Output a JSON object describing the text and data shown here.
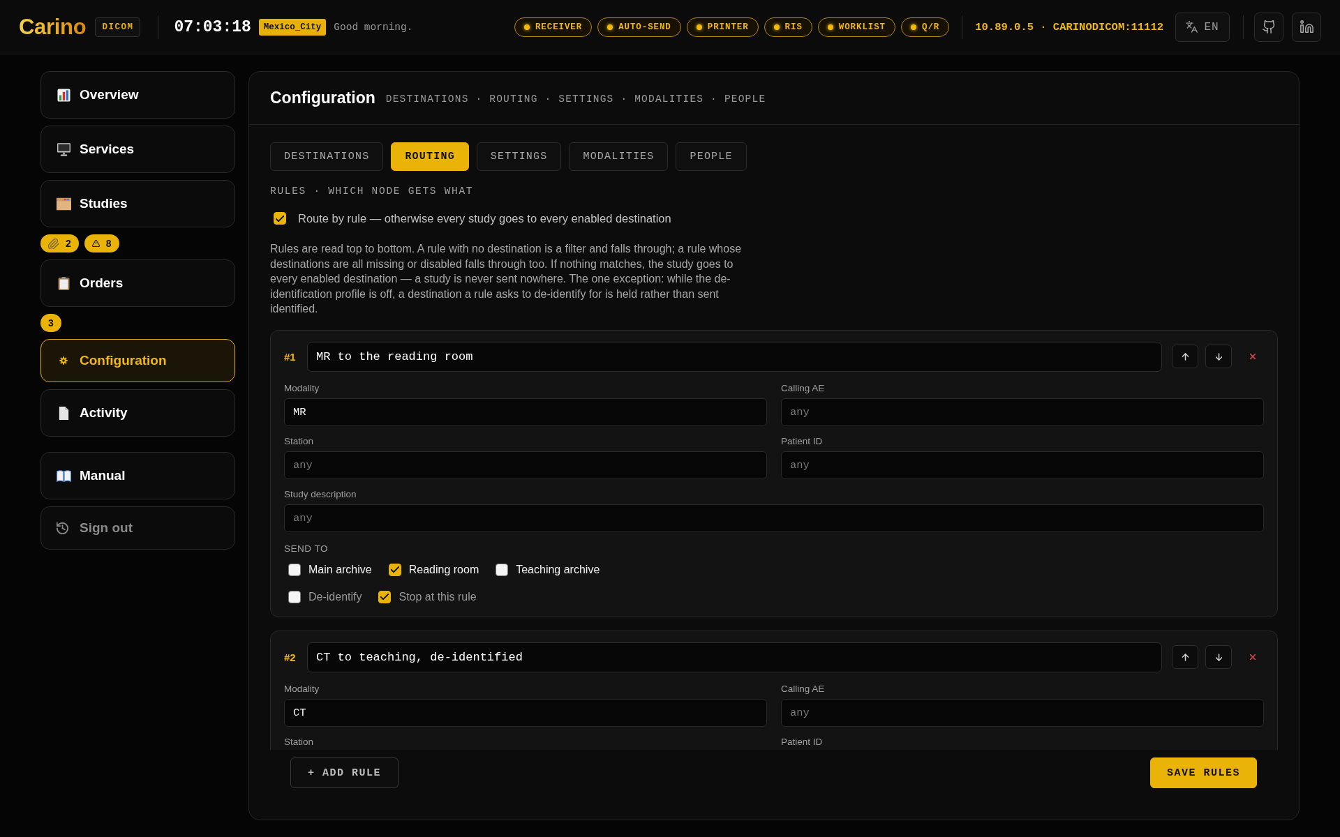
{
  "header": {
    "logo": "Carino",
    "product_badge": "DICOM",
    "clock": "07:03:18",
    "timezone": "Mexico_City",
    "greeting": "Good morning.",
    "services": [
      {
        "label": "RECEIVER",
        "on": true
      },
      {
        "label": "AUTO-SEND",
        "on": true
      },
      {
        "label": "PRINTER",
        "on": true
      },
      {
        "label": "RIS",
        "on": true
      },
      {
        "label": "WORKLIST",
        "on": true
      },
      {
        "label": "Q/R",
        "on": true
      }
    ],
    "endpoint": "10.89.0.5 · CARINODICOM:11112",
    "language": "EN"
  },
  "sidebar": {
    "sections": [
      {
        "items": [
          {
            "label": "Overview",
            "kind": "page",
            "selected": false
          },
          {
            "label": "Services",
            "kind": "page",
            "selected": false
          },
          {
            "label": "Studies",
            "kind": "page",
            "selected": false,
            "badges": [
              {
                "kind": "attachments",
                "text": "2"
              },
              {
                "kind": "warnings",
                "text": "8"
              }
            ]
          },
          {
            "label": "Orders",
            "kind": "page",
            "selected": false,
            "badges": [
              {
                "kind": "count",
                "text": "3"
              }
            ]
          },
          {
            "label": "Configuration",
            "kind": "page",
            "selected": true
          },
          {
            "label": "Activity",
            "kind": "page",
            "selected": false
          }
        ]
      },
      {
        "items": [
          {
            "label": "Manual",
            "kind": "page",
            "selected": false
          },
          {
            "label": "Sign out",
            "kind": "exit",
            "selected": false
          }
        ]
      }
    ]
  },
  "panel": {
    "title": "Configuration",
    "subtitle": "DESTINATIONS · ROUTING · SETTINGS · MODALITIES · PEOPLE",
    "tabs": [
      {
        "label": "DESTINATIONS",
        "selected": false
      },
      {
        "label": "ROUTING",
        "selected": true
      },
      {
        "label": "SETTINGS",
        "selected": false
      },
      {
        "label": "MODALITIES",
        "selected": false
      },
      {
        "label": "PEOPLE",
        "selected": false
      }
    ],
    "section_label": "RULES · WHICH NODE GETS WHAT",
    "route_by_rule": {
      "label": "Route by rule — otherwise every study goes to every enabled destination",
      "checked": true
    },
    "help_text": "Rules are read top to bottom. A rule with no destination is a filter and falls through; a rule whose destinations are all missing or disabled falls through too. If nothing matches, the study goes to every enabled destination — a study is never sent nowhere. The one exception: while the de-identification profile is off, a destination a rule asks to de-identify for is held rather than sent identified.",
    "rules": [
      {
        "number": "#1",
        "name": "MR to the reading room",
        "fields": [
          {
            "label": "Modality",
            "value": "MR"
          },
          {
            "label": "Calling AE",
            "placeholder": "any"
          },
          {
            "label": "Station",
            "placeholder": "any"
          },
          {
            "label": "Patient ID",
            "placeholder": "any"
          },
          {
            "label": "Study description",
            "placeholder": "any"
          }
        ],
        "send_to_label": "SEND TO",
        "destinations": [
          {
            "label": "Main archive",
            "checked": false
          },
          {
            "label": "Reading room",
            "checked": true
          },
          {
            "label": "Teaching archive",
            "checked": false
          }
        ],
        "options": [
          {
            "label": "De-identify",
            "checked": false
          },
          {
            "label": "Stop at this rule",
            "checked": true
          }
        ]
      },
      {
        "number": "#2",
        "name": "CT to teaching, de-identified",
        "fields": [
          {
            "label": "Modality",
            "value": "CT"
          },
          {
            "label": "Calling AE",
            "placeholder": "any"
          },
          {
            "label": "Station"
          },
          {
            "label": "Patient ID"
          }
        ]
      }
    ],
    "add_button": "+ ADD RULE",
    "save_button": "SAVE RULES"
  }
}
